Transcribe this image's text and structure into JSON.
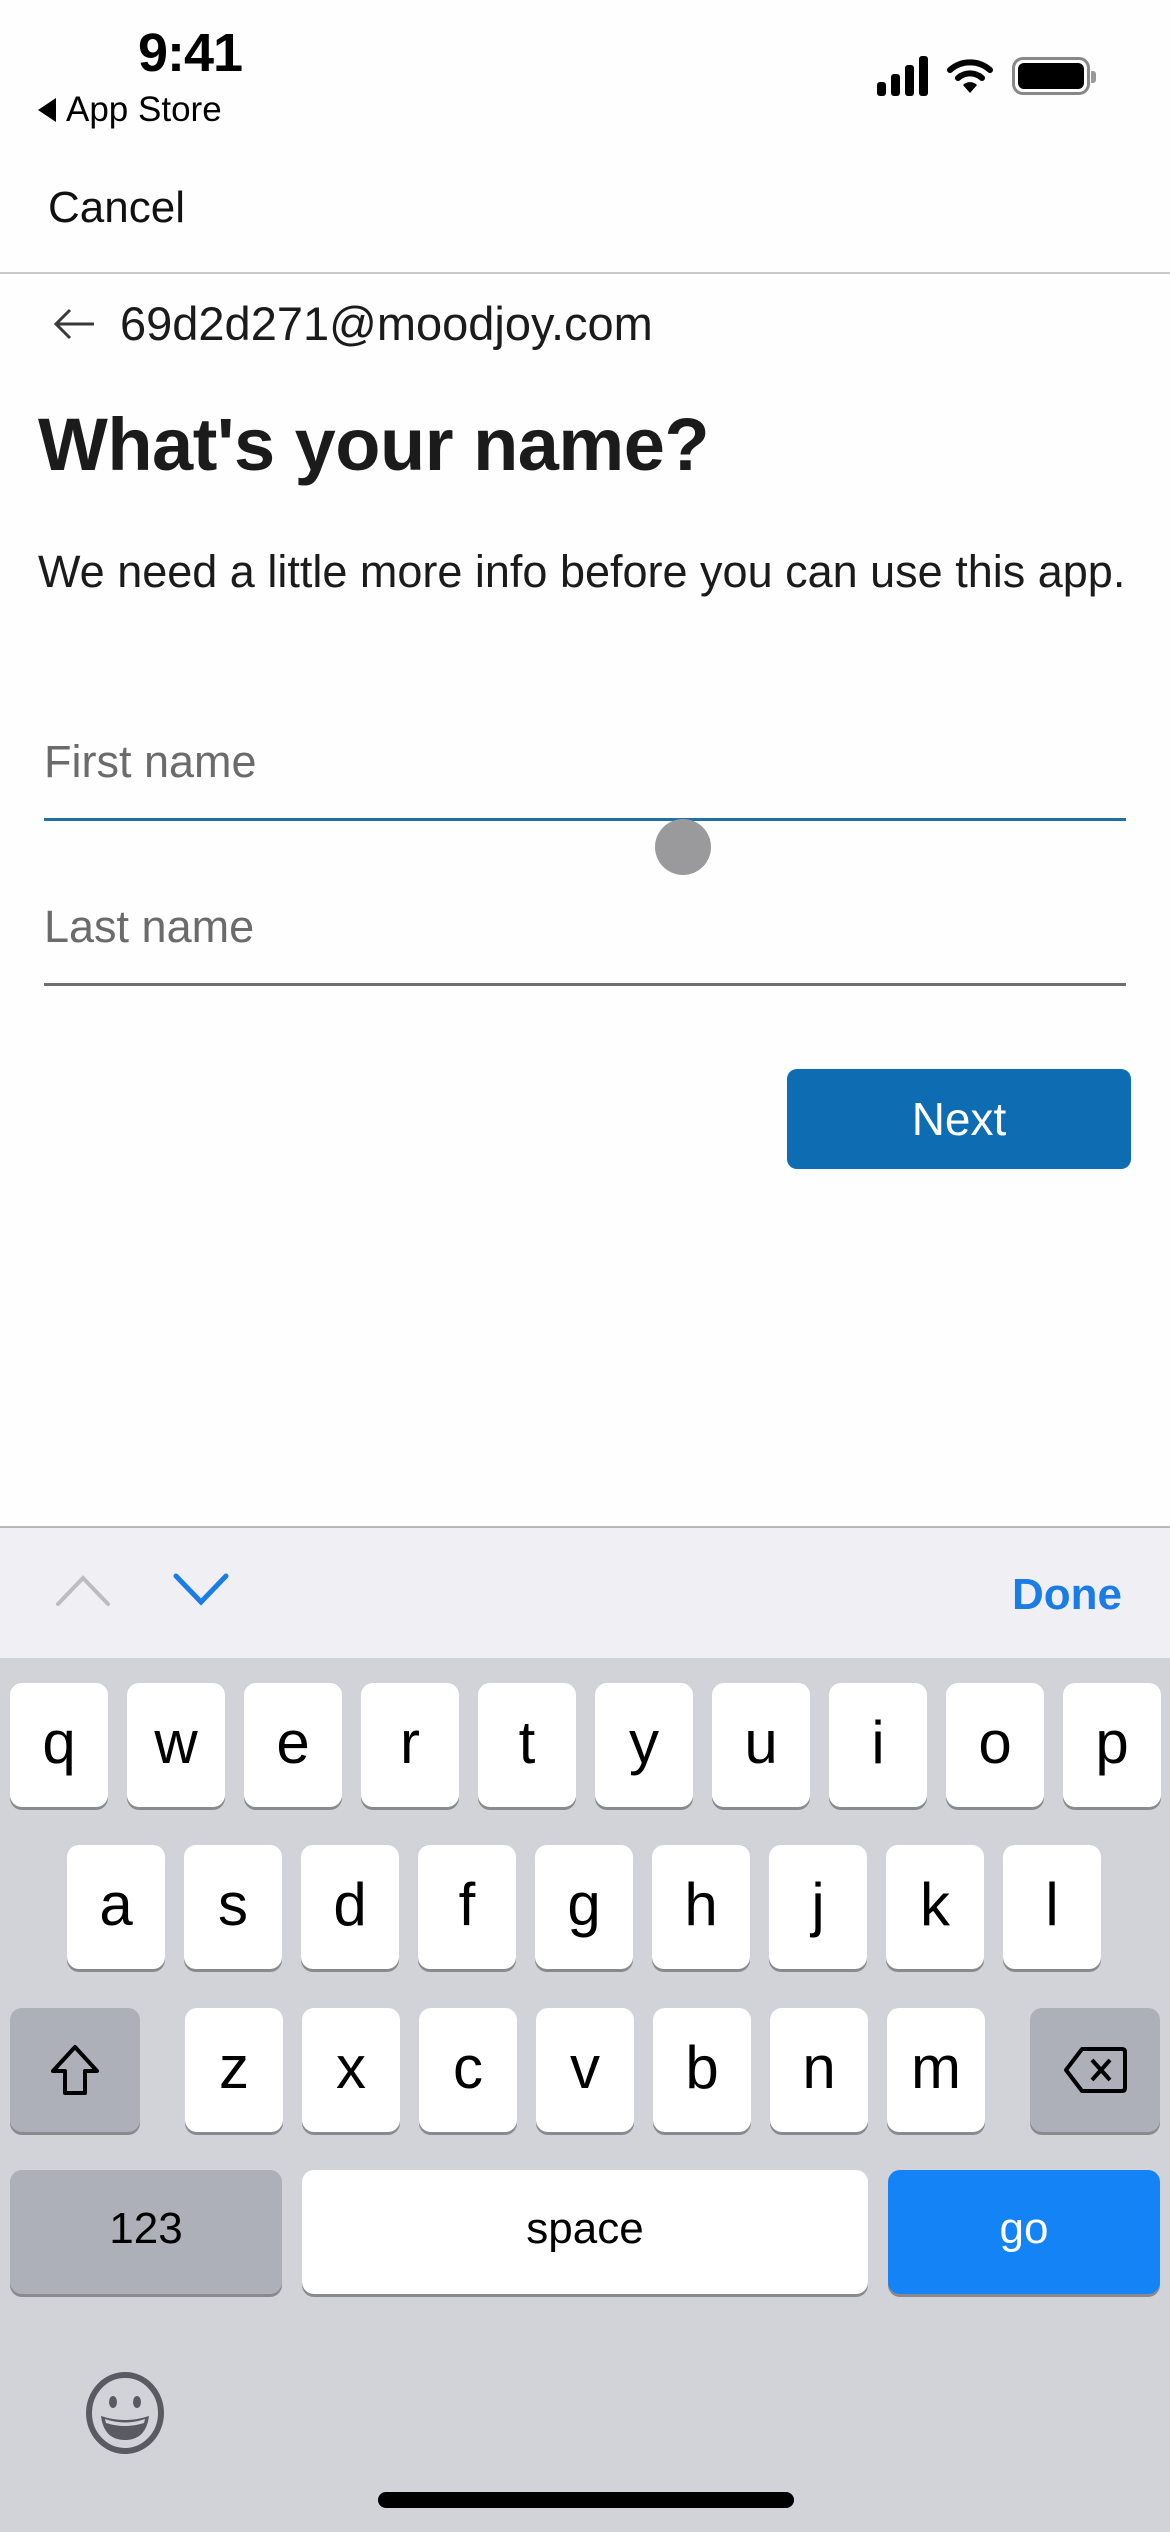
{
  "status_bar": {
    "time": "9:41",
    "back_app": "App Store",
    "icons": [
      "cellular-signal-icon",
      "wifi-icon",
      "battery-icon"
    ]
  },
  "nav": {
    "cancel_label": "Cancel"
  },
  "account": {
    "back_icon": "arrow-left-icon",
    "email": "69d2d271@moodjoy.com"
  },
  "form": {
    "heading": "What's your name?",
    "description": "We need a little more info before you can use this app.",
    "first_name": {
      "placeholder": "First name",
      "value": "",
      "focused": true
    },
    "last_name": {
      "placeholder": "Last name",
      "value": "",
      "focused": false
    },
    "next_label": "Next"
  },
  "colors": {
    "accent": "#0e6cb3",
    "focus_underline": "#1f6fa8",
    "keyboard_go": "#1383f6",
    "done_text": "#1a7ce6"
  },
  "accessory_bar": {
    "prev_icon": "chevron-up-icon",
    "next_icon": "chevron-down-icon",
    "done_label": "Done"
  },
  "keyboard": {
    "row1": [
      "q",
      "w",
      "e",
      "r",
      "t",
      "y",
      "u",
      "i",
      "o",
      "p"
    ],
    "row2": [
      "a",
      "s",
      "d",
      "f",
      "g",
      "h",
      "j",
      "k",
      "l"
    ],
    "row3": [
      "z",
      "x",
      "c",
      "v",
      "b",
      "n",
      "m"
    ],
    "shift_icon": "shift-icon",
    "delete_icon": "delete-backspace-icon",
    "numbers_label": "123",
    "space_label": "space",
    "return_label": "go",
    "emoji_icon": "emoji-icon"
  }
}
